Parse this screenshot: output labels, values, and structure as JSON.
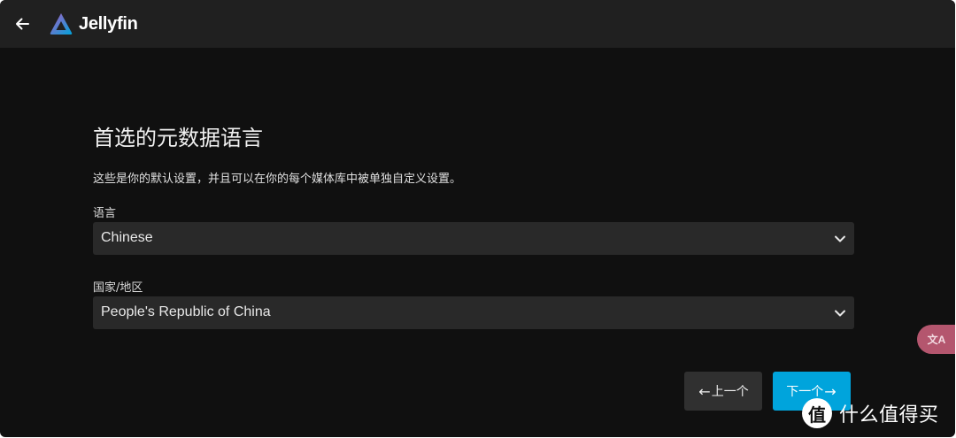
{
  "header": {
    "brand": "Jellyfin",
    "back_icon": "arrow-left-icon",
    "logo_icon": "jellyfin-triangle-icon"
  },
  "main": {
    "title": "首选的元数据语言",
    "description": "这些是你的默认设置，并且可以在你的每个媒体库中被单独自定义设置。",
    "language": {
      "label": "语言",
      "value": "Chinese"
    },
    "country": {
      "label": "国家/地区",
      "value": "People's Republic of China"
    },
    "prev_label": "上一个",
    "next_label": "下一个"
  },
  "overlay": {
    "translate_badge": "文A",
    "watermark_logo": "值",
    "watermark_text": "什么值得买"
  },
  "colors": {
    "background": "#101010",
    "header": "#202020",
    "select_bg": "#292929",
    "accent": "#00a4dc",
    "secondary_button": "#303030",
    "badge": "#b4566e"
  }
}
